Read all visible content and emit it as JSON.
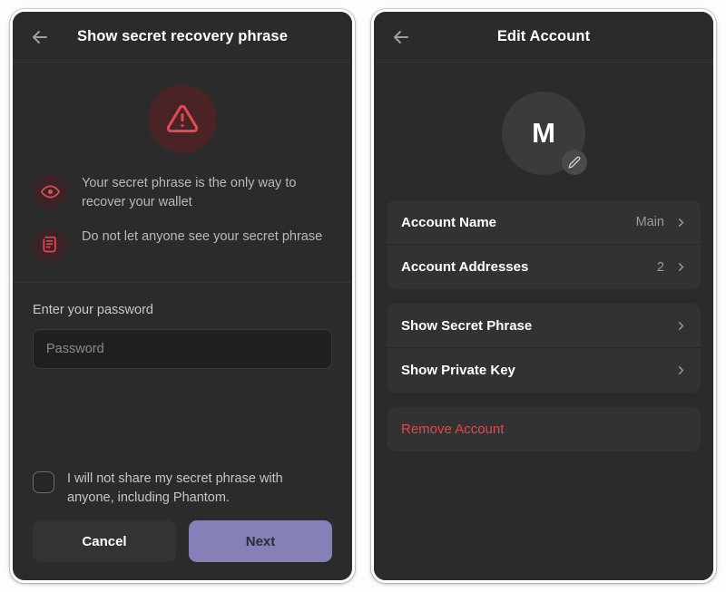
{
  "theme": {
    "panel_bg": "#2b2b2b",
    "row_bg": "#323232",
    "accent_purple": "#8680b8",
    "danger_red": "#e0484f",
    "warn_icon_bg": "#3b2226"
  },
  "left_panel": {
    "header": {
      "title": "Show secret recovery phrase",
      "back_icon": "arrow-left-icon"
    },
    "warning_badge_icon": "warning-triangle-icon",
    "warnings": [
      {
        "icon": "eye-warning-icon",
        "text": "Your secret phrase is the only way to recover your wallet"
      },
      {
        "icon": "scroll-document-icon",
        "text": "Do not let anyone see your secret phrase"
      }
    ],
    "password": {
      "label": "Enter your password",
      "placeholder": "Password",
      "value": ""
    },
    "consent": {
      "checked": false,
      "text": "I will not share my secret phrase with anyone, including Phantom."
    },
    "buttons": {
      "cancel_label": "Cancel",
      "next_label": "Next"
    }
  },
  "right_panel": {
    "header": {
      "title": "Edit Account",
      "back_icon": "arrow-left-icon"
    },
    "avatar": {
      "initial": "M",
      "edit_icon": "pencil-icon"
    },
    "groups": [
      {
        "rows": [
          {
            "label": "Account Name",
            "value": "Main",
            "chevron": "chevron-right-icon"
          },
          {
            "label": "Account Addresses",
            "value": "2",
            "chevron": "chevron-right-icon"
          }
        ]
      },
      {
        "rows": [
          {
            "label": "Show Secret Phrase",
            "value": "",
            "chevron": "chevron-right-icon"
          },
          {
            "label": "Show Private Key",
            "value": "",
            "chevron": "chevron-right-icon"
          }
        ]
      }
    ],
    "danger": {
      "label": "Remove Account"
    }
  }
}
